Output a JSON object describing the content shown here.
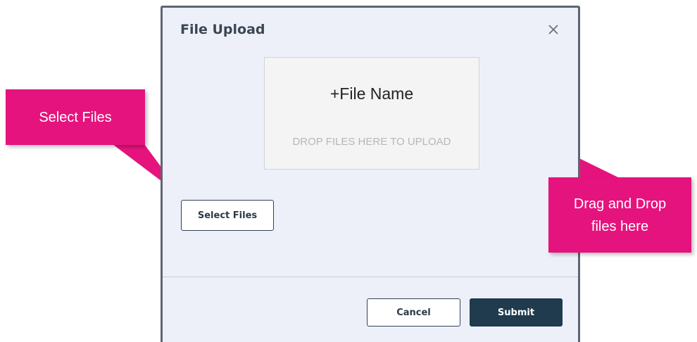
{
  "dialog": {
    "title": "File Upload",
    "close_icon": "close-icon",
    "dropzone": {
      "file_name": "+File Name",
      "hint": "DROP FILES HERE TO UPLOAD"
    },
    "select_files_label": "Select Files",
    "cancel_label": "Cancel",
    "submit_label": "Submit"
  },
  "annotations": {
    "select_files": "Select Files",
    "drag_drop": "Drag and Drop files here",
    "color": "#e5137d"
  },
  "colors": {
    "dialog_bg": "#eef0f9",
    "submit_bg": "#1f3b4d"
  }
}
